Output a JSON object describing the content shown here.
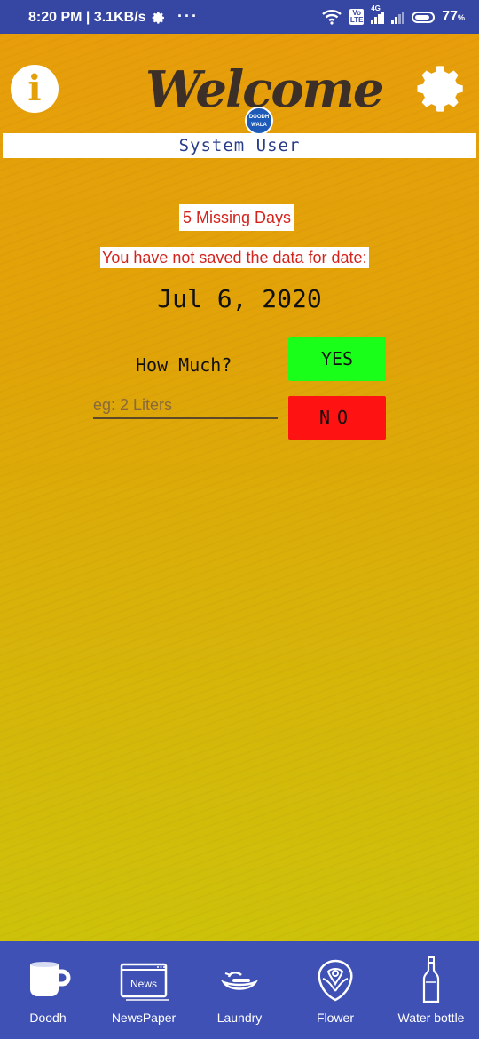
{
  "status_bar": {
    "time_speed": "8:20 PM | 3.1KB/s",
    "dots": "···",
    "network_label": "4G",
    "volte": "Vo LTE",
    "battery": "77"
  },
  "header": {
    "welcome": "Welcome",
    "logo_text": "DOODH WALA"
  },
  "user": {
    "name": "System User"
  },
  "alerts": {
    "missing_days": "5 Missing Days",
    "not_saved": "You have not saved the data for date:"
  },
  "entry": {
    "date": "Jul 6, 2020",
    "how_much": "How Much?",
    "placeholder": "eg: 2 Liters",
    "yes_label": "YES",
    "no_label": "NO"
  },
  "nav": {
    "items": [
      {
        "label": "Doodh",
        "icon": "cup-icon"
      },
      {
        "label": "NewsPaper",
        "icon": "newspaper-icon",
        "icon_text": "News"
      },
      {
        "label": "Laundry",
        "icon": "laundry-icon"
      },
      {
        "label": "Flower",
        "icon": "flower-icon"
      },
      {
        "label": "Water bottle",
        "icon": "water-bottle-icon"
      }
    ]
  },
  "colors": {
    "status_bar": "#3646a3",
    "bottom_nav": "#3f51b5",
    "bg_top": "#e79e0a",
    "bg_bottom": "#cdc20a",
    "yes": "#19ff19",
    "no": "#ff1212",
    "alert_text": "#d3231c"
  }
}
